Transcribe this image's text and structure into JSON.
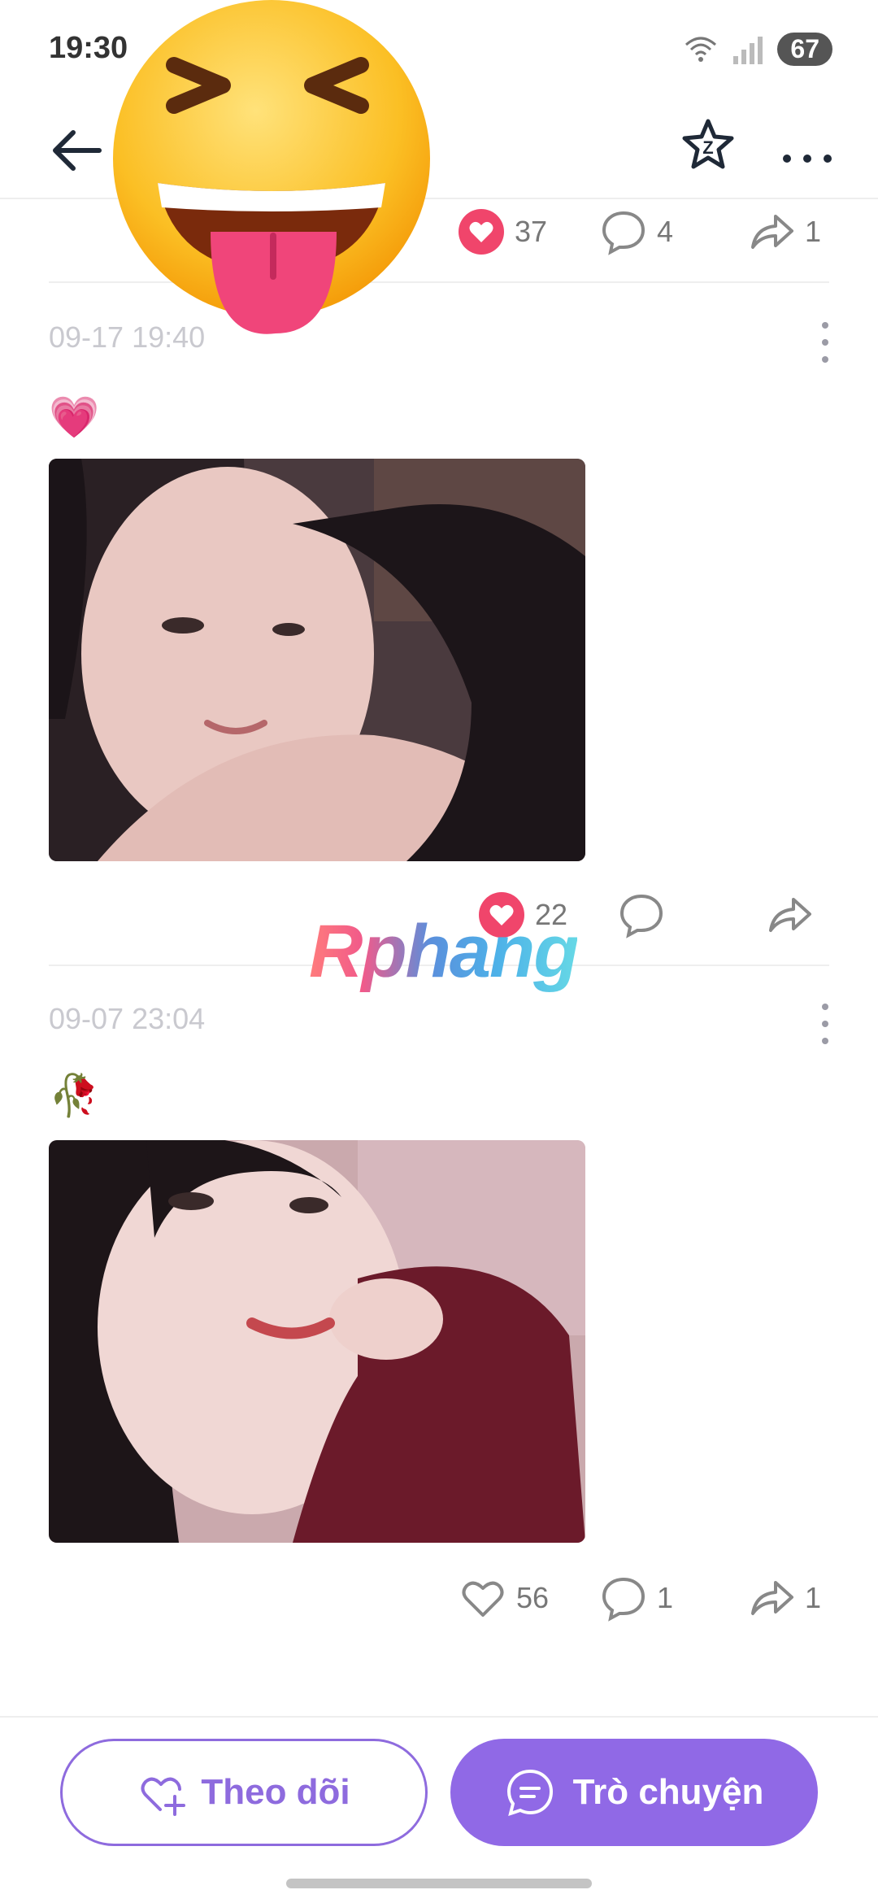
{
  "status_bar": {
    "time": "19:30",
    "battery": "67"
  },
  "header": {
    "back": "back",
    "favorite_badge": "Z"
  },
  "posts": [
    {
      "likes": "37",
      "comments": "4",
      "shares": "1",
      "liked": true
    },
    {
      "date": "09-17 19:40",
      "emoji": "💗",
      "likes": "22",
      "comments": "",
      "shares": "",
      "liked": true
    },
    {
      "date": "09-07 23:04",
      "emoji": "🥀",
      "likes": "56",
      "comments": "1",
      "shares": "1",
      "liked": false
    }
  ],
  "watermark": "Rphang",
  "bottom_bar": {
    "follow_label": "Theo dõi",
    "chat_label": "Trò chuyện"
  },
  "colors": {
    "accent": "#9069e6",
    "like": "#f0456b",
    "text_muted": "#c9c9cf"
  }
}
